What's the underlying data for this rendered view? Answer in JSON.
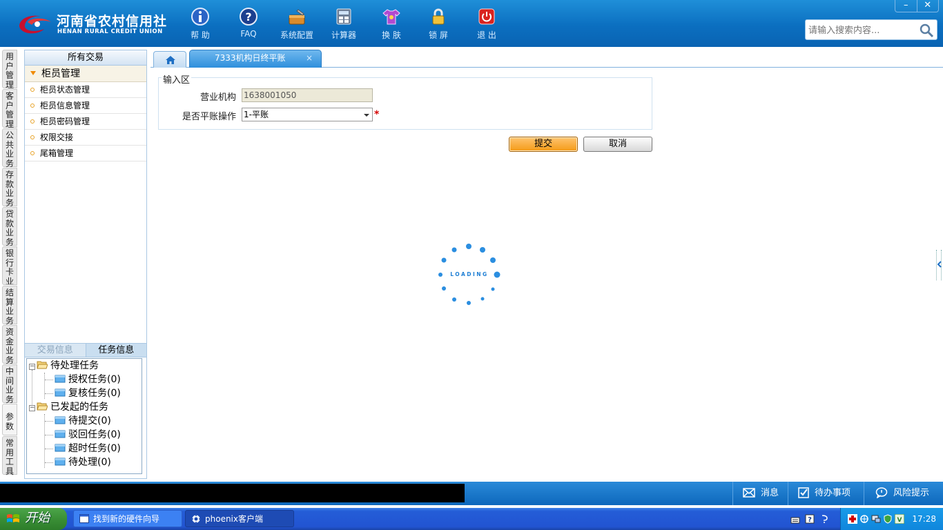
{
  "header": {
    "logo_cn": "河南省农村信用社",
    "logo_en": "HENAN RURAL CREDIT UNION",
    "tools": [
      "帮 助",
      "FAQ",
      "系统配置",
      "计算器",
      "换 肤",
      "锁 屏",
      "退 出"
    ],
    "window_minimize": "–",
    "window_close": "✕",
    "search_placeholder": "请输入搜索内容..."
  },
  "vnav": [
    "用户管理",
    "客户管理",
    "公共业务",
    "存款业务",
    "贷款业务",
    "银行卡业务",
    "结算业务",
    "资金业务",
    "中间业务",
    "参数",
    "常用工具"
  ],
  "leftpanel": {
    "header": "所有交易",
    "group": "柜员管理",
    "items": [
      "柜员状态管理",
      "柜员信息管理",
      "柜员密码管理",
      "权限交接",
      "尾箱管理"
    ],
    "tab_trade": "交易信息",
    "tab_task": "任务信息",
    "tree": {
      "pending": "待处理任务",
      "pending_children": [
        "授权任务(0)",
        "复核任务(0)"
      ],
      "initiated": "已发起的任务",
      "initiated_children": [
        "待提交(0)",
        "驳回任务(0)",
        "超时任务(0)",
        "待处理(0)"
      ]
    }
  },
  "tabs": {
    "active": "7333机构日终平账",
    "close": "×"
  },
  "form": {
    "legend": "输入区",
    "org_label": "营业机构",
    "org_value": "1638001050",
    "balance_label": "是否平账操作",
    "balance_value": "1-平账",
    "required_mark": "*",
    "submit": "提交",
    "cancel": "取消"
  },
  "loading_text": "LOADING",
  "statusbar": {
    "messages": "消息",
    "todo": "待办事项",
    "risk": "风险提示"
  },
  "taskbar": {
    "start": "开始",
    "tasks": [
      "找到新的硬件向导",
      "phoenix客户端"
    ],
    "clock": "17:28"
  },
  "colors": {
    "header_blue": "#0b6fc0",
    "accent_orange": "#f49a16",
    "required_red": "#d40000"
  }
}
